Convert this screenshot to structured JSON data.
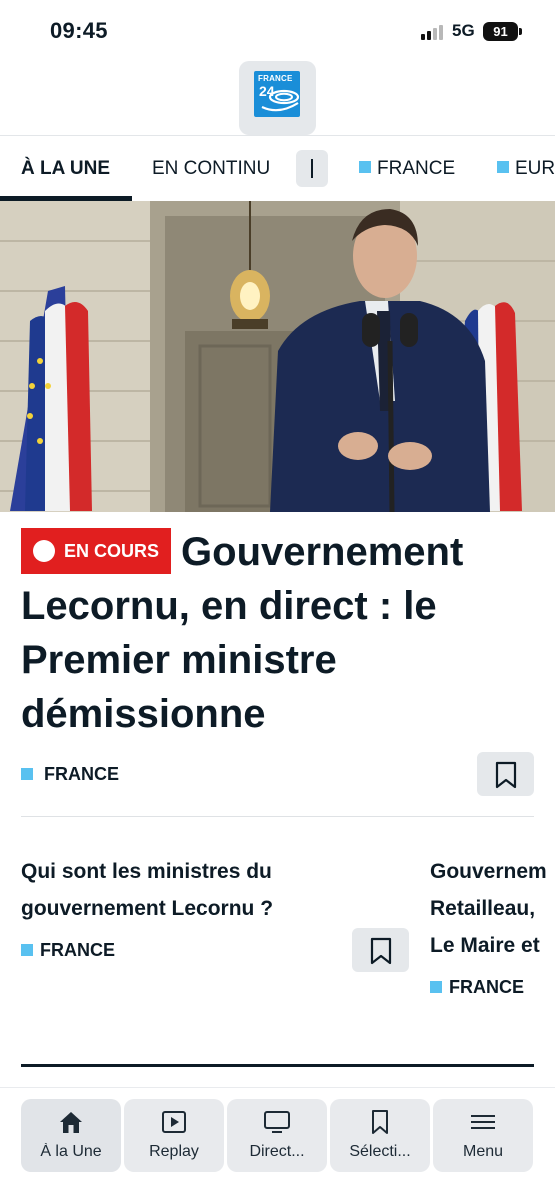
{
  "status_bar": {
    "time": "09:45",
    "network": "5G",
    "battery": "91"
  },
  "header": {
    "logo_line1": "FRANCE",
    "logo_line2": "24"
  },
  "tabs": [
    {
      "label": "À LA UNE",
      "active": true
    },
    {
      "label": "EN CONTINU",
      "active": false
    },
    {
      "label": "FRANCE",
      "active": false
    },
    {
      "label": "EUR",
      "active": false
    }
  ],
  "hero_article": {
    "badge": "EN COURS",
    "title": "Gouvernement Lecornu, en direct : le Premier ministre démissionne",
    "category": "FRANCE"
  },
  "cards": [
    {
      "title_line1": "Qui sont les ministres du",
      "title_line2": "gouvernement Lecornu ?",
      "category": "FRANCE"
    },
    {
      "title_line1": "Gouvernem",
      "title_line2": "Retailleau,",
      "title_line3": "Le Maire et",
      "category": "FRANCE"
    }
  ],
  "bottom_nav": [
    {
      "label": "À la Une",
      "icon": "home-icon"
    },
    {
      "label": "Replay",
      "icon": "play-icon"
    },
    {
      "label": "Direct...",
      "icon": "tv-icon"
    },
    {
      "label": "Sélecti...",
      "icon": "bookmark-icon"
    },
    {
      "label": "Menu",
      "icon": "menu-icon"
    }
  ],
  "colors": {
    "accent_blue": "#59c1f0",
    "live_red": "#e11f1f",
    "text_dark": "#0d1b26"
  }
}
